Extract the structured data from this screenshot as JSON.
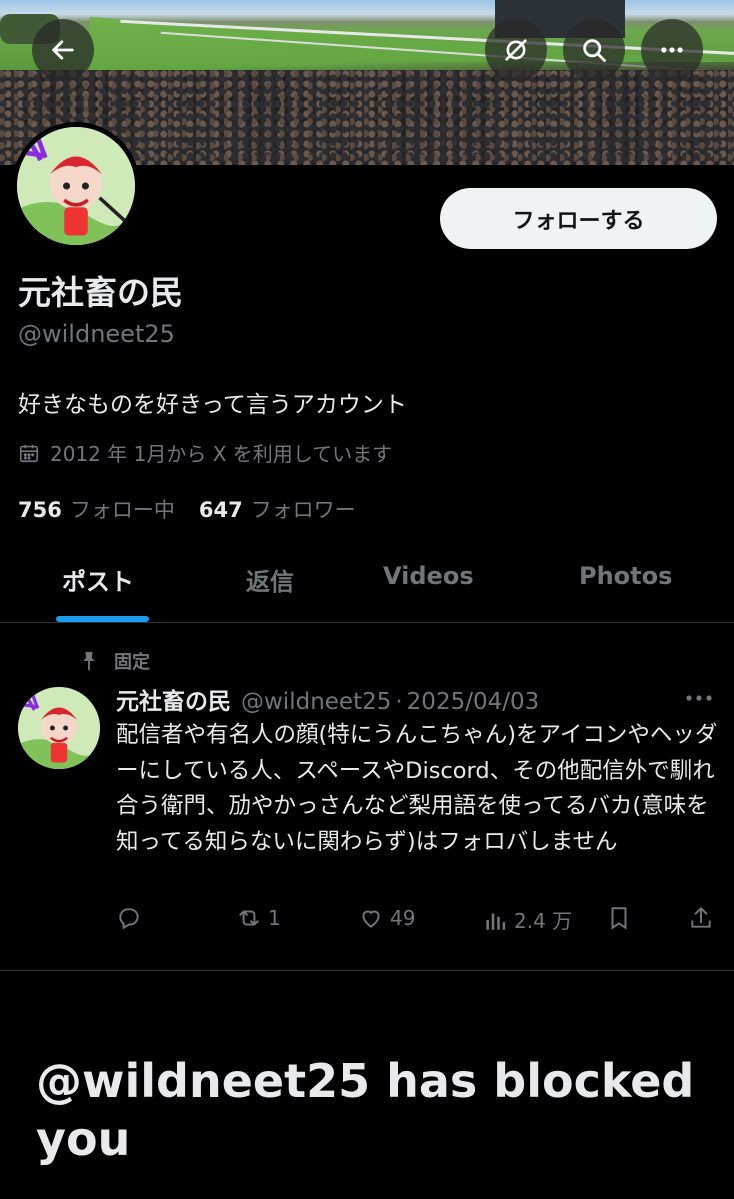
{
  "header": {
    "back_icon": "arrow-left-icon",
    "actions": [
      "grok-icon",
      "search-icon",
      "more-icon"
    ]
  },
  "profile": {
    "name": "元社畜の民",
    "handle": "@wildneet25",
    "bio": "好きなものを好きって言うアカウント",
    "joined": "2012 年 1月から X を利用しています",
    "following_count": "756",
    "following_label": "フォロー中",
    "followers_count": "647",
    "followers_label": "フォロワー",
    "follow_button": "フォローする"
  },
  "tabs": [
    {
      "label": "ポスト",
      "active": true
    },
    {
      "label": "返信",
      "active": false
    },
    {
      "label": "Videos",
      "active": false
    },
    {
      "label": "Photos",
      "active": false
    }
  ],
  "post": {
    "pinned_label": "固定",
    "author_name": "元社畜の民",
    "author_handle": "@wildneet25",
    "separator": "·",
    "date": "2025/04/03",
    "text": "配信者や有名人の顔(特にうんこちゃん)をアイコンやヘッダーにしている人、スペースやDiscord、その他配信外で馴れ合う衛門、劢やかっさんなど梨用語を使ってるバカ(意味を知ってる知らないに関わらず)はフォロバしません",
    "replies": "",
    "reposts": "1",
    "likes": "49",
    "views": "2.4 万"
  },
  "blocked_message": "@wildneet25 has blocked you",
  "colors": {
    "accent": "#1d9bf0",
    "background": "#000000",
    "secondary_text": "#71767b",
    "primary_text": "#e7e9ea"
  }
}
